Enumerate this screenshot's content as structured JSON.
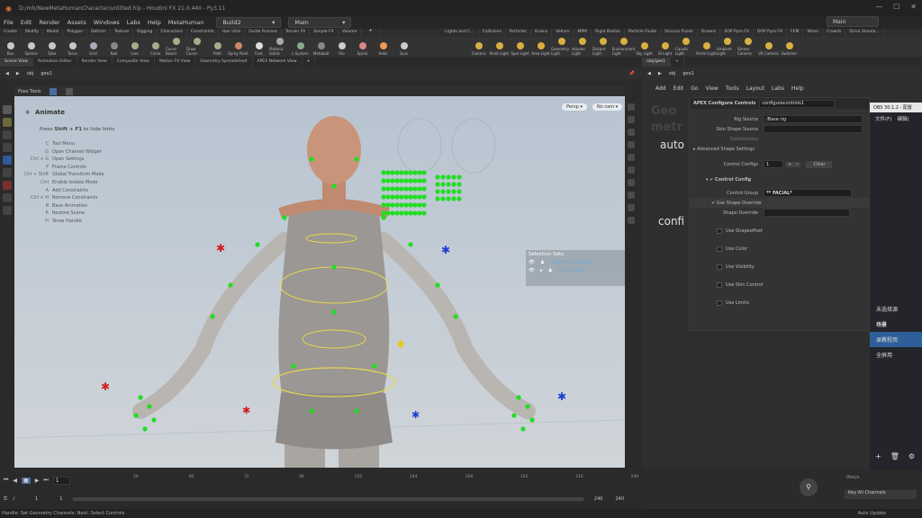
{
  "titlebar": {
    "path": "D:/mh/NewMetaHumanCharacter/untitled.hip - Houdini FX 21.0.440 - Py3.11",
    "window_title": "Main"
  },
  "menu": {
    "items": [
      "File",
      "Edit",
      "Render",
      "Assets",
      "Windows",
      "Labs",
      "Help",
      "MetaHuman"
    ],
    "build": "Build2",
    "main": "Main"
  },
  "shelf_tabs": [
    "Create",
    "Modify",
    "Model",
    "Polygon",
    "Deform",
    "Texture",
    "Rigging",
    "Characters",
    "Constraints",
    "Hair Utils",
    "Guide Process",
    "Terrain FX",
    "Simple FX",
    "Volume"
  ],
  "shelf_tabs_right": [
    "Lights and C...",
    "Collisions",
    "Particles",
    "Grains",
    "Vellum",
    "MPM",
    "Rigid Bodies",
    "Particle Fluids",
    "Viscous Fluids",
    "Oceans",
    "SOP Pyro FX",
    "DOP Pyro FX",
    "FEM",
    "Wires",
    "Crowds",
    "Drive Simula..."
  ],
  "tools_left": [
    "Box",
    "Sphere",
    "Tube",
    "Torus",
    "Grid",
    "Null",
    "Line",
    "Circle",
    "Curve Bezier",
    "Draw Curve",
    "Path",
    "Spray Paint",
    "Font",
    "Platonic Solids",
    "L-System",
    "Metaball",
    "File",
    "Spiral",
    "Helix",
    "Quic"
  ],
  "tools_right": [
    "Camera",
    "Point Light",
    "Spot Light",
    "Area Light",
    "Geometry Light",
    "Volume Light",
    "Distant Light",
    "Environment Light",
    "Sky Light",
    "GI Light",
    "Caustic Light",
    "Portal Light",
    "Ambient Light",
    "Stereo Camera",
    "VR Camera",
    "Switcher"
  ],
  "pane_tabs_left": [
    "Scene View",
    "Animation Editor",
    "Render View",
    "Composite View",
    "Motion FX View",
    "Geometry Spreadsheet",
    "APEX Network View"
  ],
  "pane_tabs_right": [
    "/obj/geo1"
  ],
  "path_left": {
    "obj": "obj",
    "geo": "geo1"
  },
  "path_right": {
    "obj": "obj",
    "geo": "geo1"
  },
  "pose_tools": "Pose Tools",
  "viewport": {
    "mode": "Animate",
    "hint_prefix": "Press",
    "hint_key": "Shift + F1",
    "hint_suffix": "to hide hints",
    "persp": "Persp",
    "cam": "No cam",
    "hints": [
      {
        "key": "C",
        "text": "Tool Menu"
      },
      {
        "key": "G",
        "text": "Open Channel Widget"
      },
      {
        "key": "Ctrl + G",
        "text": "Open Settings"
      },
      {
        "key": "F",
        "text": "Frame Controls"
      },
      {
        "key": "Ctrl + Shift",
        "text": "Global Transform Mode"
      },
      {
        "key": "Ctrl",
        "text": "Enable Isolate Mode"
      },
      {
        "key": "A",
        "text": "Add Constraints"
      },
      {
        "key": "Ctrl + H",
        "text": "Remove Constraints"
      },
      {
        "key": "B",
        "text": "Base Animation"
      },
      {
        "key": "R",
        "text": "Restore Scene"
      },
      {
        "key": "H",
        "text": "Show Handle"
      }
    ]
  },
  "selection_sets": {
    "title": "Selection Sets",
    "items": [
      "Current Selection",
      "All Controls"
    ]
  },
  "timeline": {
    "ticks": [
      "24",
      "48",
      "72",
      "96",
      "120",
      "144",
      "168",
      "192",
      "216",
      "240"
    ],
    "current_frame": "1",
    "start": "1",
    "start2": "1",
    "end": "240",
    "end2": "240"
  },
  "status": "Handle: Set Geometry Channels; Next: Select Controls",
  "right_menu": [
    "Add",
    "Edit",
    "Go",
    "View",
    "Tools",
    "Layout",
    "Labs",
    "Help"
  ],
  "node_bg": {
    "geo": "Geo",
    "metr": "metr",
    "auto": "auto",
    "confi": "confi"
  },
  "apex": {
    "node_type": "APEX Configure Controls",
    "node_name": "configurecontrols1",
    "rig_source_label": "Rig Source",
    "rig_source_value": "/Base.rig",
    "shape_source_label": "Skin Shape Source",
    "subdivisions_label": "Subdivisions",
    "advanced": "Advanced Shape Settings",
    "control_configs_label": "Control Configs",
    "control_configs_value": "1",
    "clear": "Clear",
    "control_config": "Control Config",
    "control_group_label": "Control Group",
    "control_group_value": "** FACIAL*",
    "use_shape_override": "Use Shape Override",
    "shape_override_label": "Shape Override",
    "options": [
      "Use Shapeoffset",
      "Use Color",
      "Use Visibility",
      "Use Skin Control",
      "Use Limits"
    ]
  },
  "obs": {
    "title": "OBS 30.1.2 - 配置",
    "menu": [
      "文件(F)",
      "编辑("
    ],
    "scene_none": "未选择源",
    "scenes_header": "场景",
    "scenes": [
      "录教程用",
      "全屏用"
    ]
  },
  "bottom_right": {
    "keys": "0keys",
    "key_all": "Key All Channels",
    "auto_update": "Auto Update"
  }
}
